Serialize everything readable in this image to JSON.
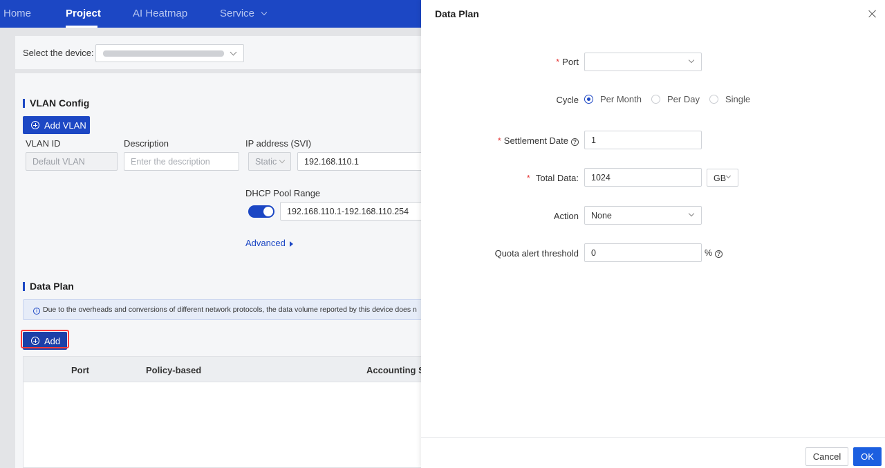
{
  "nav": {
    "items": [
      "Home",
      "Project",
      "AI Heatmap",
      "Service"
    ]
  },
  "device": {
    "label": "Select the device:"
  },
  "vlan": {
    "section_title": "VLAN Config",
    "add_button": "Add VLAN",
    "vlan_id_label": "VLAN ID",
    "vlan_id_value": "Default VLAN",
    "description_label": "Description",
    "description_placeholder": "Enter the description",
    "ip_label": "IP address (SVI)",
    "ip_mode": "Static",
    "ip_value": "192.168.110.1",
    "dhcp_label": "DHCP Pool Range",
    "dhcp_enabled": true,
    "dhcp_range": "192.168.110.1-192.168.110.254",
    "advanced_link": "Advanced"
  },
  "data_plan": {
    "section_title": "Data Plan",
    "notice": "Due to the overheads and conversions of different network protocols, the data volume reported by this device does n",
    "add_button": "Add",
    "columns": [
      "Port",
      "Policy-based",
      "Accounting St"
    ]
  },
  "drawer": {
    "title": "Data Plan",
    "port_label": "Port",
    "port_value": "",
    "cycle_label": "Cycle",
    "cycle_options": [
      "Per Month",
      "Per Day",
      "Single"
    ],
    "cycle_selected": "Per Month",
    "settlement_label": "Settlement Date",
    "settlement_value": "1",
    "total_label": "Total Data:",
    "total_value": "1024",
    "total_unit": "GB",
    "action_label": "Action",
    "action_value": "None",
    "quota_label": "Quota alert threshold",
    "quota_value": "0",
    "quota_unit": "%",
    "cancel_label": "Cancel",
    "ok_label": "OK"
  },
  "colors": {
    "primary": "#1c47c4",
    "ok_button": "#1c5fe0",
    "required": "#e63b3b",
    "highlight": "#ff3b3b"
  }
}
